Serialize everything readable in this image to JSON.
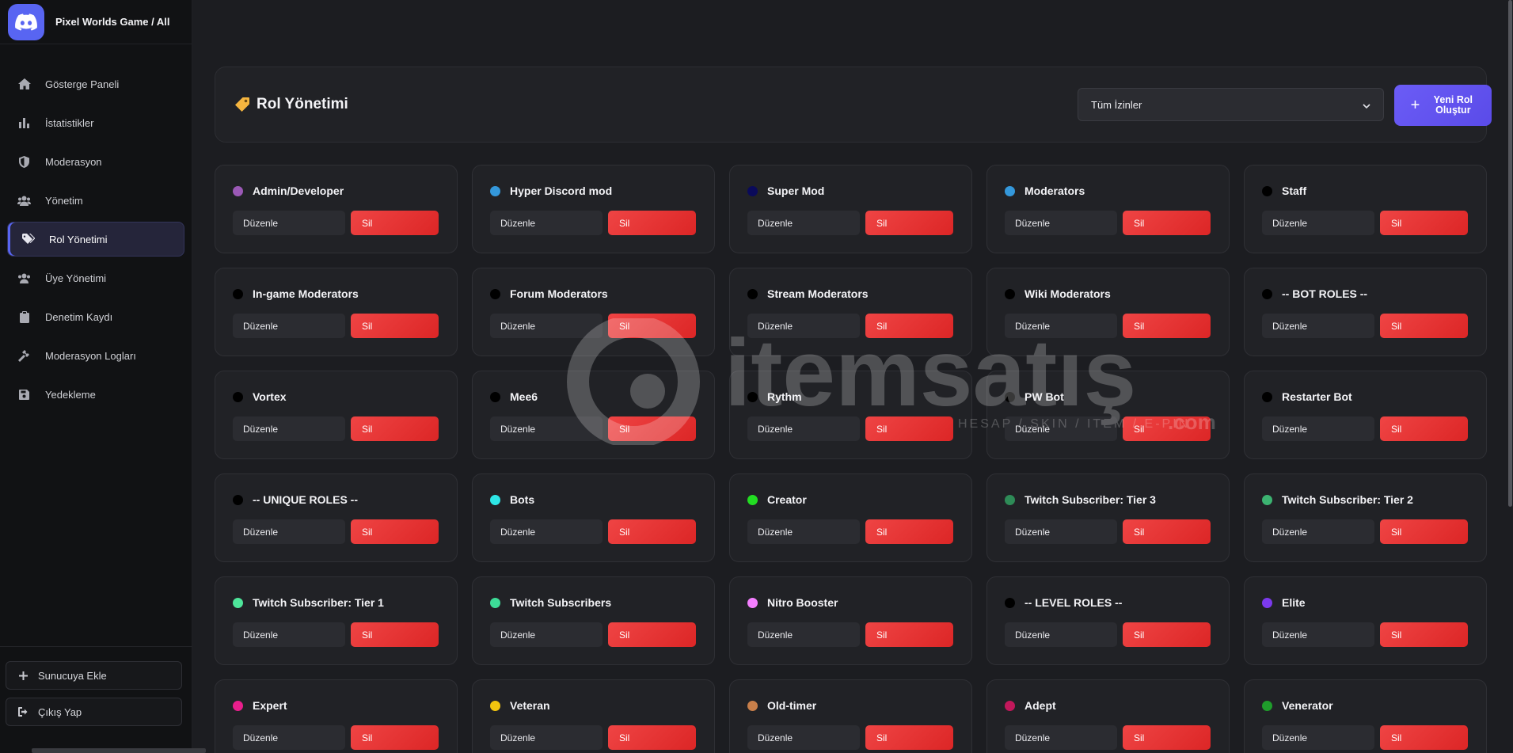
{
  "brand": {
    "name": "Pixel Worlds Game / All",
    "logo_icon": "discord-icon"
  },
  "sidebar": {
    "items": [
      {
        "label": "Gösterge Paneli",
        "icon": "home-icon",
        "active": false
      },
      {
        "label": "İstatistikler",
        "icon": "bar-chart-icon",
        "active": false
      },
      {
        "label": "Moderasyon",
        "icon": "shield-icon",
        "active": false
      },
      {
        "label": "Yönetim",
        "icon": "users-icon",
        "active": false
      },
      {
        "label": "Rol Yönetimi",
        "icon": "tags-icon",
        "active": true
      },
      {
        "label": "Üye Yönetimi",
        "icon": "users-icon",
        "active": false
      },
      {
        "label": "Denetim Kaydı",
        "icon": "clipboard-icon",
        "active": false
      },
      {
        "label": "Moderasyon Logları",
        "icon": "hammer-icon",
        "active": false
      },
      {
        "label": "Yedekleme",
        "icon": "save-icon",
        "active": false
      }
    ],
    "add_server": "Sunucuya Ekle",
    "logout": "Çıkış Yap"
  },
  "header": {
    "title": "Rol Yönetimi",
    "filter_value": "Tüm İzinler",
    "new_role_label": "Yeni Rol Oluştur"
  },
  "role_actions": {
    "edit": "Düzenle",
    "delete": "Sil"
  },
  "roles": [
    {
      "name": "Admin/Developer",
      "color": "#9b59b6"
    },
    {
      "name": "Hyper Discord mod",
      "color": "#3498db"
    },
    {
      "name": "Super Mod",
      "color": "#0a0a5a"
    },
    {
      "name": "Moderators",
      "color": "#3498db"
    },
    {
      "name": "Staff",
      "color": "#000000"
    },
    {
      "name": "In-game Moderators",
      "color": "#000000"
    },
    {
      "name": "Forum Moderators",
      "color": "#000000"
    },
    {
      "name": "Stream Moderators",
      "color": "#000000"
    },
    {
      "name": "Wiki Moderators",
      "color": "#000000"
    },
    {
      "name": "-- BOT ROLES --",
      "color": "#000000"
    },
    {
      "name": "Vortex",
      "color": "#000000"
    },
    {
      "name": "Mee6",
      "color": "#000000"
    },
    {
      "name": "Rythm",
      "color": "#000000"
    },
    {
      "name": "PW Bot",
      "color": "#000000"
    },
    {
      "name": "Restarter Bot",
      "color": "#000000"
    },
    {
      "name": "-- UNIQUE ROLES --",
      "color": "#000000"
    },
    {
      "name": "Bots",
      "color": "#2ee6e6"
    },
    {
      "name": "Creator",
      "color": "#22dd22"
    },
    {
      "name": "Twitch Subscriber: Tier 3",
      "color": "#2e8b57"
    },
    {
      "name": "Twitch Subscriber: Tier 2",
      "color": "#3cb371"
    },
    {
      "name": "Twitch Subscriber: Tier 1",
      "color": "#4ee59a"
    },
    {
      "name": "Twitch Subscribers",
      "color": "#3ddc97"
    },
    {
      "name": "Nitro Booster",
      "color": "#f47fff"
    },
    {
      "name": "-- LEVEL ROLES --",
      "color": "#000000"
    },
    {
      "name": "Elite",
      "color": "#7c3aed"
    },
    {
      "name": "Expert",
      "color": "#e91e8c"
    },
    {
      "name": "Veteran",
      "color": "#f1c40f"
    },
    {
      "name": "Old-timer",
      "color": "#c87f4a"
    },
    {
      "name": "Adept",
      "color": "#c2185b"
    },
    {
      "name": "Venerator",
      "color": "#1f9d2b"
    }
  ],
  "watermark": {
    "brand": "itemsatış",
    "tagline": "HESAP / SKIN / ITEM / E-PIN",
    "domain": ".com"
  }
}
